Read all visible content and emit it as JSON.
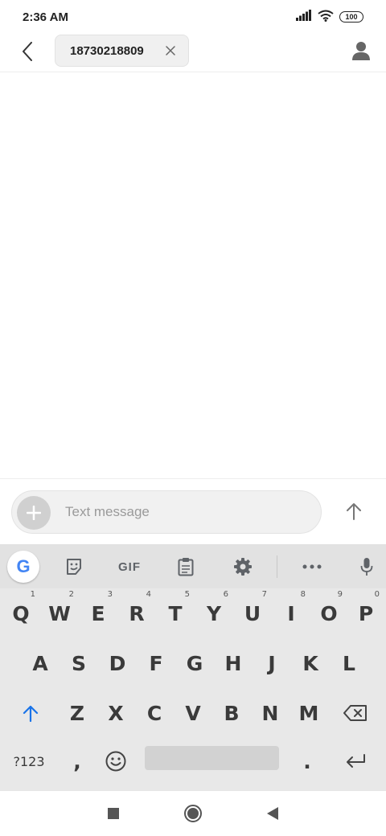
{
  "status_bar": {
    "time": "2:36 AM",
    "battery": "100"
  },
  "header": {
    "recipient": "18730218809"
  },
  "compose": {
    "placeholder": "Text message"
  },
  "keyboard": {
    "toolbar": {
      "google": "G",
      "gif": "GIF"
    },
    "row1": [
      {
        "label": "Q",
        "hint": "1"
      },
      {
        "label": "W",
        "hint": "2"
      },
      {
        "label": "E",
        "hint": "3"
      },
      {
        "label": "R",
        "hint": "4"
      },
      {
        "label": "T",
        "hint": "5"
      },
      {
        "label": "Y",
        "hint": "6"
      },
      {
        "label": "U",
        "hint": "7"
      },
      {
        "label": "I",
        "hint": "8"
      },
      {
        "label": "O",
        "hint": "9"
      },
      {
        "label": "P",
        "hint": "0"
      }
    ],
    "row2": [
      "A",
      "S",
      "D",
      "F",
      "G",
      "H",
      "J",
      "K",
      "L"
    ],
    "row3": [
      "Z",
      "X",
      "C",
      "V",
      "B",
      "N",
      "M"
    ],
    "row4": {
      "symbols": "?123",
      "comma": ",",
      "period": "."
    }
  },
  "colors": {
    "accent": "#1a73e8",
    "keyboard_bg": "#e8e8e8",
    "key_text": "#3a3a3a"
  }
}
